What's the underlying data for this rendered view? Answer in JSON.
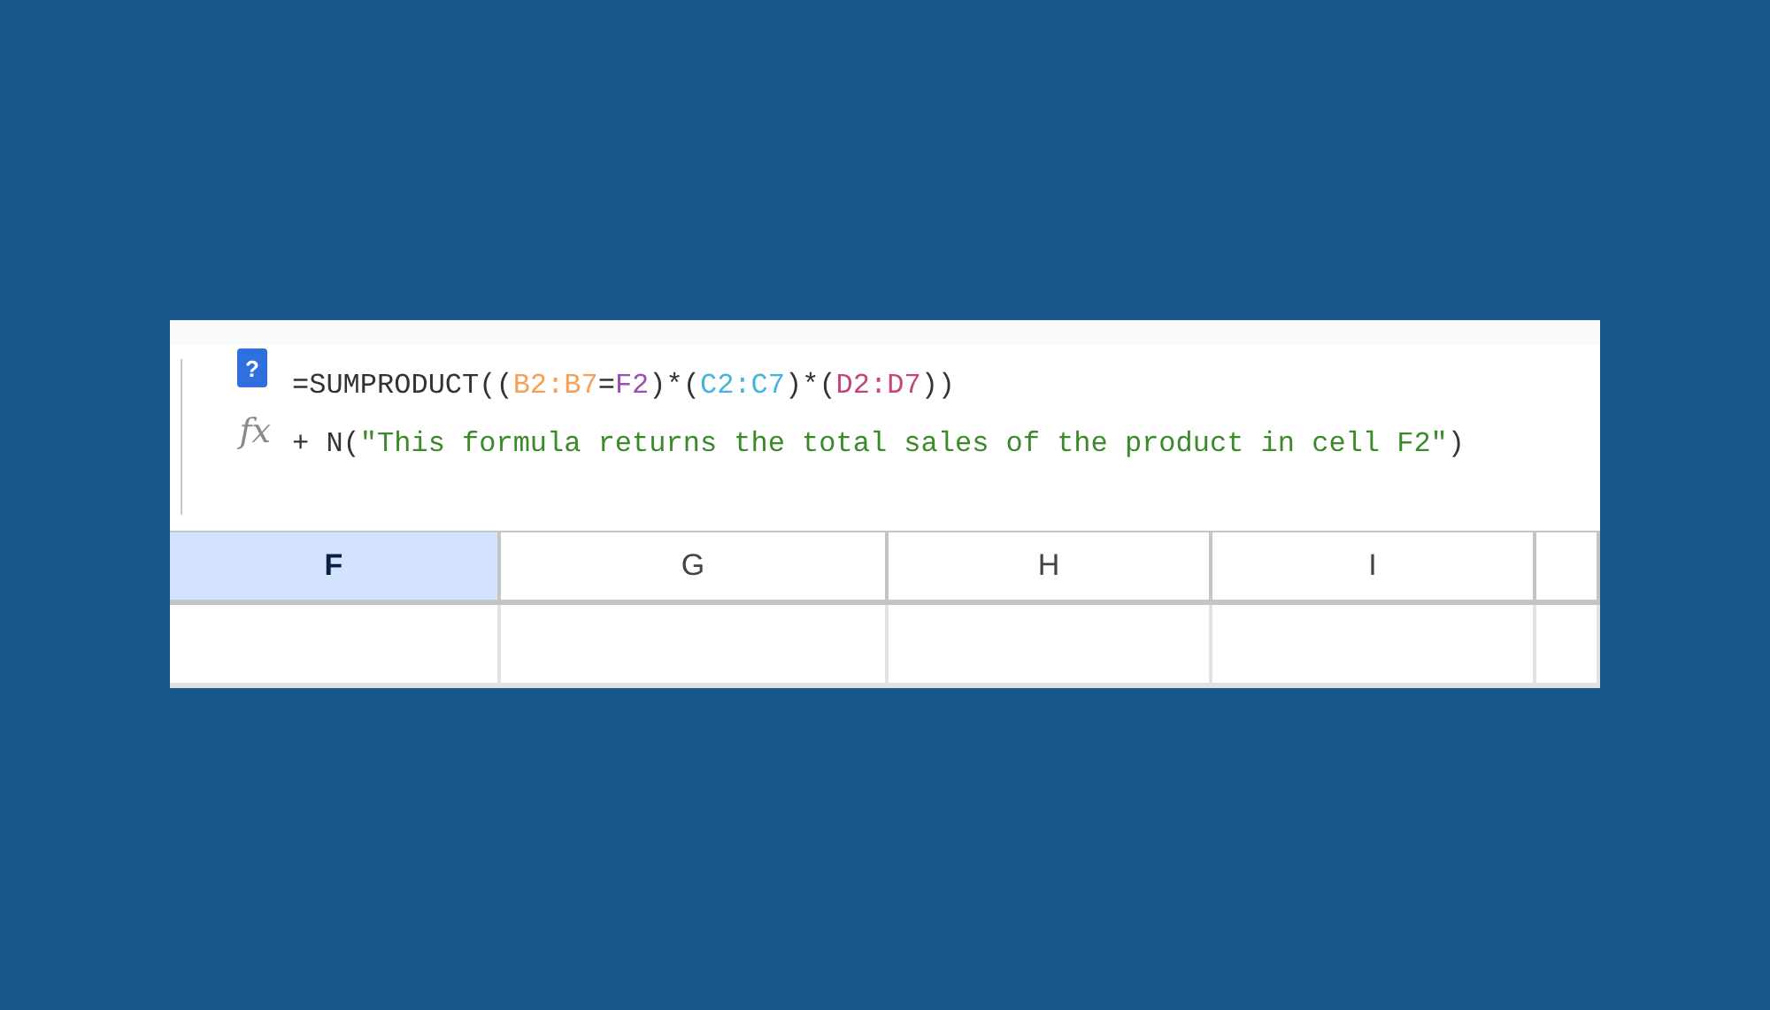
{
  "formula_bar": {
    "help_badge": "?",
    "fx_label": "fx",
    "lines": [
      {
        "tokens": [
          {
            "kind": "plain",
            "text": "=SUMPRODUCT(("
          },
          {
            "kind": "ref",
            "text": "B2:B7",
            "color": "#f5a05a"
          },
          {
            "kind": "plain",
            "text": "="
          },
          {
            "kind": "ref",
            "text": "F2",
            "color": "#9b4fb5"
          },
          {
            "kind": "plain",
            "text": ")*("
          },
          {
            "kind": "ref",
            "text": "C2:C7",
            "color": "#45b3dd"
          },
          {
            "kind": "plain",
            "text": ")*("
          },
          {
            "kind": "ref",
            "text": "D2:D7",
            "color": "#c2457c"
          },
          {
            "kind": "plain",
            "text": "))"
          }
        ]
      },
      {
        "tokens": [
          {
            "kind": "plain",
            "text": "+ N("
          },
          {
            "kind": "string",
            "text": "\"This formula returns the total sales of the product in cell F2\""
          },
          {
            "kind": "plain",
            "text": ")"
          }
        ]
      }
    ]
  },
  "columns": [
    {
      "label": "F",
      "selected": true
    },
    {
      "label": "G",
      "selected": false
    },
    {
      "label": "H",
      "selected": false
    },
    {
      "label": "I",
      "selected": false
    }
  ]
}
